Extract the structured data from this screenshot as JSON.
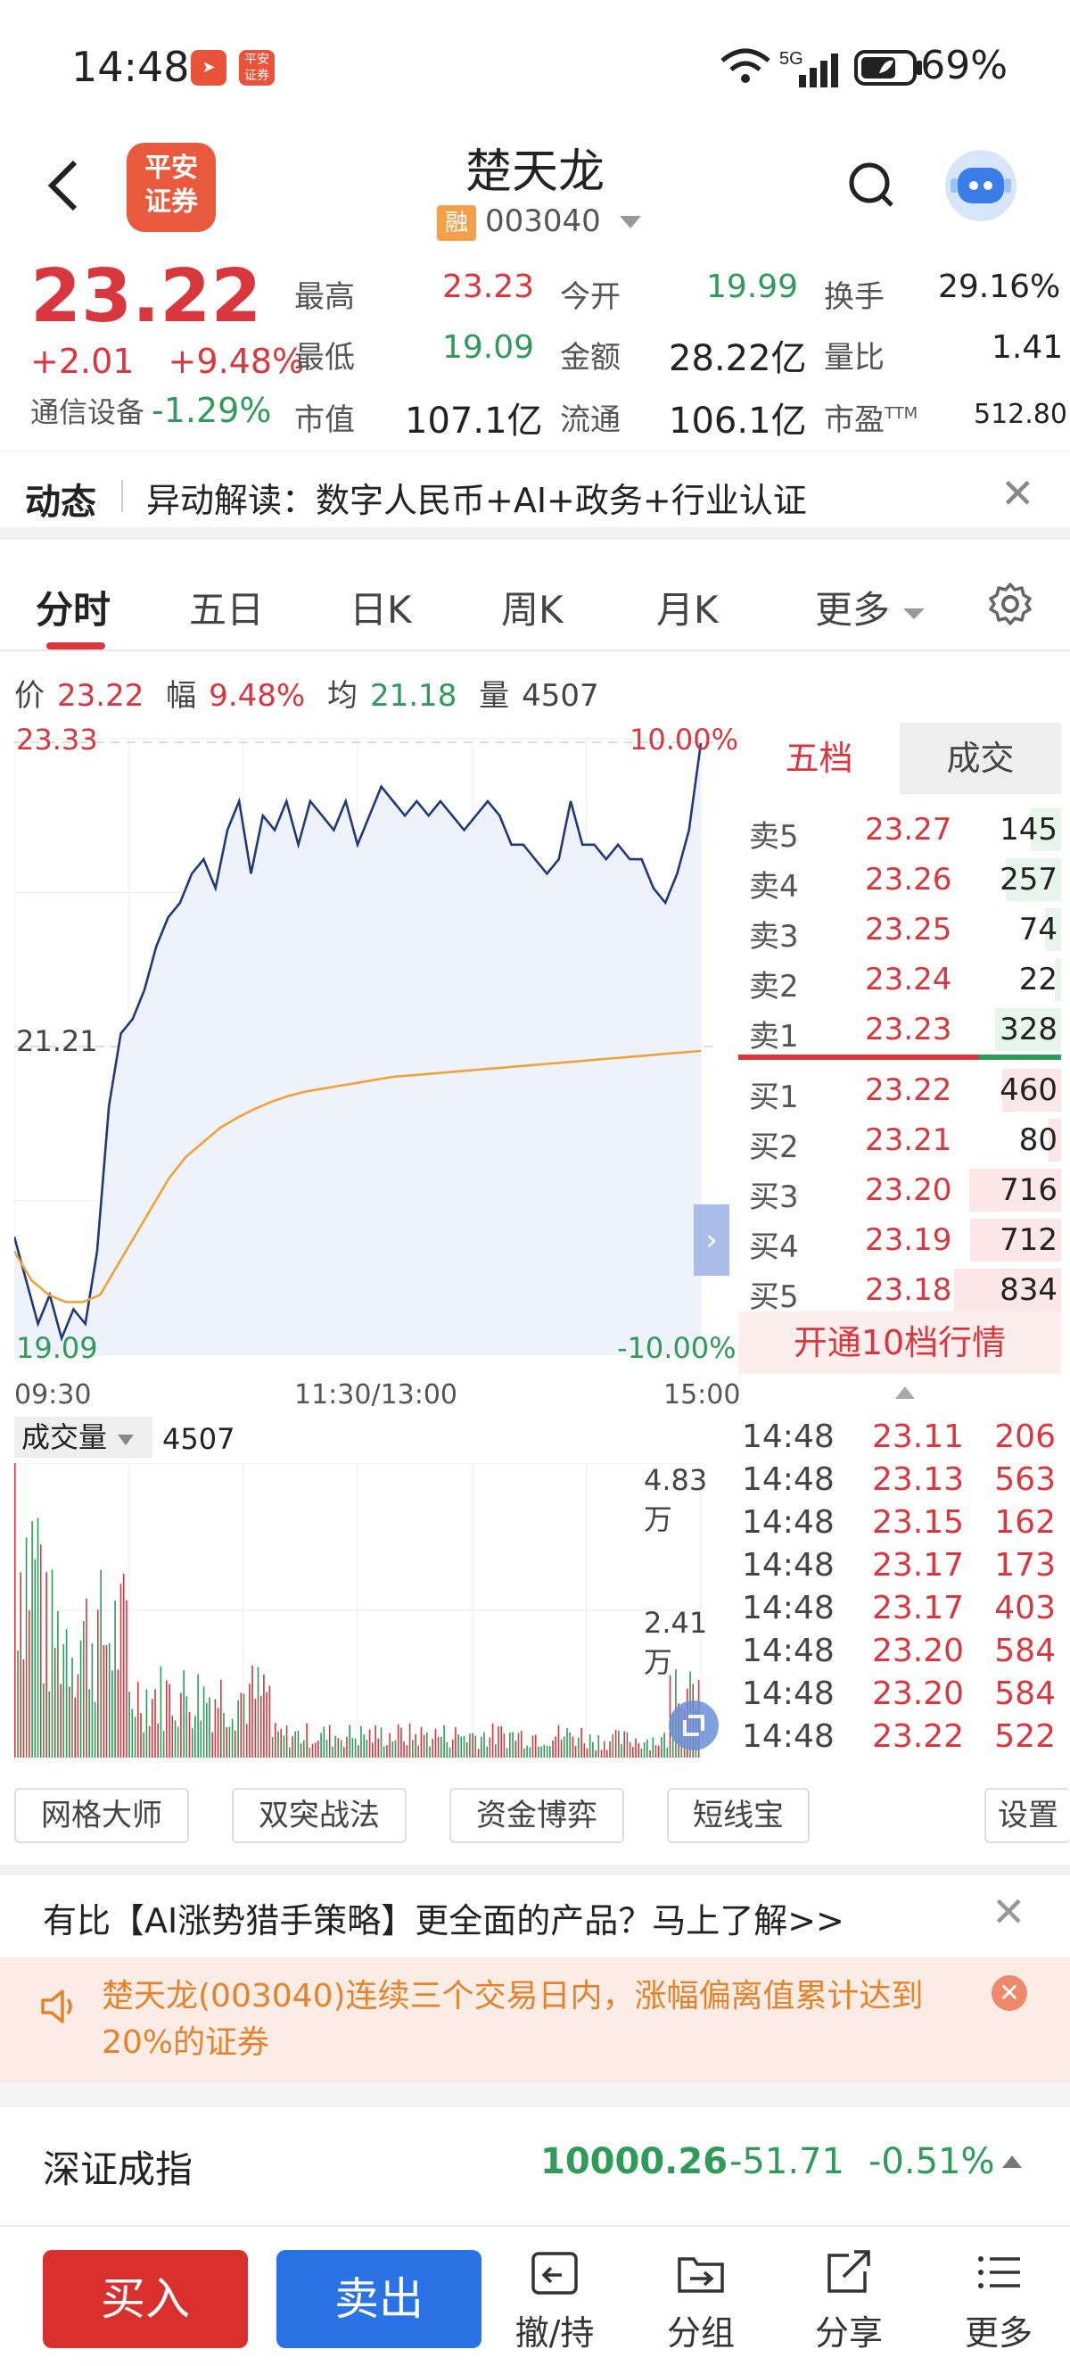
{
  "status": {
    "time": "14:48",
    "app_icons": [
      "telegram-app-icon",
      "pingan-app-icon"
    ],
    "battery": "69%",
    "network": "5G"
  },
  "header": {
    "logo_line1": "平安",
    "logo_line2": "证券",
    "stock_name": "楚天龙",
    "rong_badge": "融",
    "stock_code": "003040"
  },
  "quote": {
    "price": "23.22",
    "change": "+2.01",
    "change_pct": "+9.48%",
    "sector_name": "通信设备",
    "sector_pct": "-1.29%",
    "cells": [
      {
        "label": "最高",
        "value": "23.23",
        "color": "red"
      },
      {
        "label": "今开",
        "value": "19.99",
        "color": "green"
      },
      {
        "label": "换手",
        "value": "29.16%",
        "color": "black"
      },
      {
        "label": "最低",
        "value": "19.09",
        "color": "green"
      },
      {
        "label": "金额",
        "value": "28.22亿",
        "color": "black"
      },
      {
        "label": "量比",
        "value": "1.41",
        "color": "black"
      },
      {
        "label": "市值",
        "value": "107.1亿",
        "color": "black"
      },
      {
        "label": "流通",
        "value": "106.1亿",
        "color": "black"
      },
      {
        "label": "市盈",
        "value": "512.80",
        "color": "black",
        "sup": "TTM"
      }
    ]
  },
  "news": {
    "tag": "动态",
    "text": "异动解读：数字人民币+AI+政务+行业认证"
  },
  "tabs": [
    "分时",
    "五日",
    "日K",
    "周K",
    "月K",
    "更多"
  ],
  "info_line": {
    "price_label": "价",
    "price": "23.22",
    "amp_label": "幅",
    "amp": "9.48%",
    "avg_label": "均",
    "avg": "21.18",
    "vol_label": "量",
    "vol": "4507"
  },
  "chart_data": {
    "type": "line",
    "title": "",
    "xlabel": "",
    "ylabel": "",
    "x_ticks": [
      "09:30",
      "11:30/13:00",
      "15:00"
    ],
    "y_top": "23.33",
    "y_mid": "21.21",
    "y_bottom": "19.09",
    "pct_top": "10.00%",
    "pct_bottom": "-10.00%",
    "ylim": [
      19.09,
      23.33
    ],
    "series": [
      {
        "values": [
          19.9,
          19.6,
          19.3,
          19.5,
          19.2,
          19.4,
          19.3,
          19.8,
          20.8,
          21.3,
          21.4,
          21.6,
          21.9,
          22.1,
          22.2,
          22.4,
          22.5,
          22.3,
          22.7,
          22.9,
          22.4,
          22.8,
          22.7,
          22.9,
          22.6,
          22.9,
          22.8,
          22.7,
          22.9,
          22.6,
          22.8,
          23.0,
          22.9,
          22.8,
          22.9,
          22.8,
          22.9,
          22.8,
          22.7,
          22.8,
          22.9,
          22.8,
          22.6,
          22.6,
          22.5,
          22.4,
          22.5,
          22.9,
          22.6,
          22.6,
          22.5,
          22.6,
          22.5,
          22.5,
          22.3,
          22.2,
          22.4,
          22.7,
          23.3
        ]
      },
      {
        "values": [
          19.8,
          19.6,
          19.5,
          19.45,
          19.45,
          19.5,
          19.7,
          19.9,
          20.1,
          20.3,
          20.45,
          20.55,
          20.65,
          20.72,
          20.78,
          20.83,
          20.87,
          20.9,
          20.92,
          20.94,
          20.96,
          20.98,
          21.0,
          21.01,
          21.02,
          21.03,
          21.04,
          21.05,
          21.06,
          21.07,
          21.08,
          21.09,
          21.1,
          21.11,
          21.12,
          21.13,
          21.14,
          21.15,
          21.16,
          21.17,
          21.18
        ]
      }
    ]
  },
  "book": {
    "tab_active": "五档",
    "tab_inactive": "成交",
    "asks": [
      {
        "label": "卖5",
        "price": "23.27",
        "vol": "145",
        "bar": 0.28
      },
      {
        "label": "卖4",
        "price": "23.26",
        "vol": "257",
        "bar": 0.52
      },
      {
        "label": "卖3",
        "price": "23.25",
        "vol": "74",
        "bar": 0.15
      },
      {
        "label": "卖2",
        "price": "23.24",
        "vol": "22",
        "bar": 0.06
      },
      {
        "label": "卖1",
        "price": "23.23",
        "vol": "328",
        "bar": 0.62
      }
    ],
    "bids": [
      {
        "label": "买1",
        "price": "23.22",
        "vol": "460",
        "bar": 0.55
      },
      {
        "label": "买2",
        "price": "23.21",
        "vol": "80",
        "bar": 0.12
      },
      {
        "label": "买3",
        "price": "23.20",
        "vol": "716",
        "bar": 0.86
      },
      {
        "label": "买4",
        "price": "23.19",
        "vol": "712",
        "bar": 0.85
      },
      {
        "label": "买5",
        "price": "23.18",
        "vol": "834",
        "bar": 1.0
      }
    ],
    "open_10": "开通10档行情"
  },
  "volume": {
    "label": "成交量",
    "value": "4507",
    "top": "4.83万",
    "mid": "2.41万"
  },
  "ticks": [
    {
      "time": "14:48",
      "price": "23.11",
      "vol": "206"
    },
    {
      "time": "14:48",
      "price": "23.13",
      "vol": "563"
    },
    {
      "time": "14:48",
      "price": "23.15",
      "vol": "162"
    },
    {
      "time": "14:48",
      "price": "23.17",
      "vol": "173"
    },
    {
      "time": "14:48",
      "price": "23.17",
      "vol": "403"
    },
    {
      "time": "14:48",
      "price": "23.20",
      "vol": "584"
    },
    {
      "time": "14:48",
      "price": "23.20",
      "vol": "584"
    },
    {
      "time": "14:48",
      "price": "23.22",
      "vol": "522"
    }
  ],
  "tools": [
    "网格大师",
    "双突战法",
    "资金博弈",
    "短线宝",
    "设置"
  ],
  "promo": "有比【AI涨势猎手策略】更全面的产品？马上了解>>",
  "warning": "楚天龙(003040)连续三个交易日内，涨幅偏离值累计达到20%的证券",
  "index": {
    "name": "深证成指",
    "value": "10000.26",
    "change": "-51.71",
    "pct": "-0.51%"
  },
  "bottom": {
    "buy": "买入",
    "sell": "卖出",
    "withdraw": "撤/持",
    "group": "分组",
    "share": "分享",
    "more": "更多"
  }
}
